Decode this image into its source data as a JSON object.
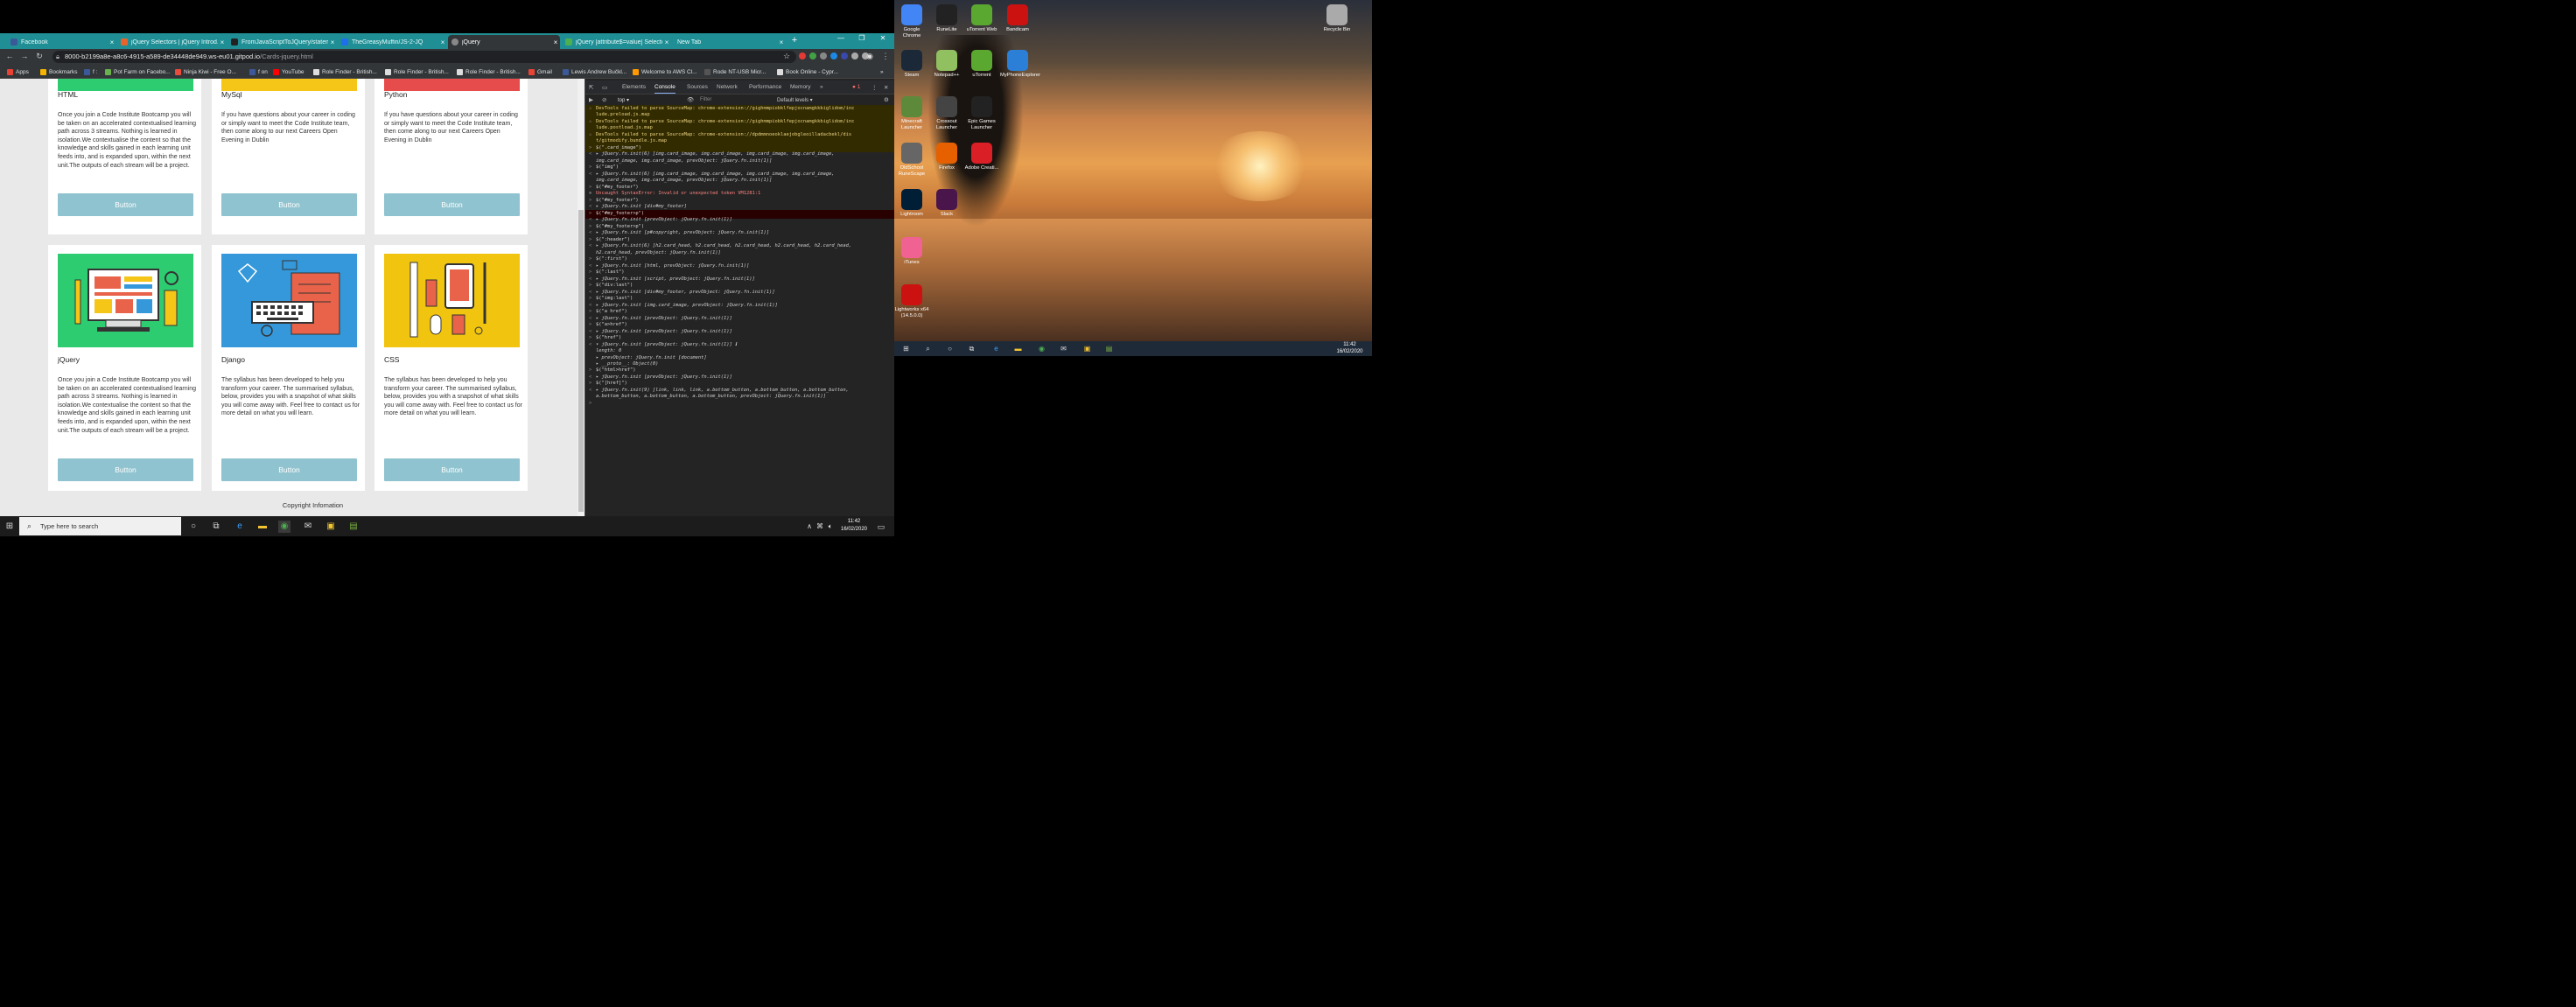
{
  "browser": {
    "tabs": [
      {
        "label": "Facebook",
        "color": "#3b5998",
        "active": false
      },
      {
        "label": "jQuery Selectors | jQuery Introd...",
        "color": "#e8632b",
        "active": false
      },
      {
        "label": "FromJavaScriptToJQuery/statem...",
        "color": "#222222",
        "active": false
      },
      {
        "label": "TheGreasyMuffin/JS-2-JQ",
        "color": "#1f6feb",
        "active": false
      },
      {
        "label": "jQuery",
        "color": "#888888",
        "active": true
      },
      {
        "label": "jQuery [attribute$=value] Selecto...",
        "color": "#4caf50",
        "active": false
      },
      {
        "label": "New Tab",
        "color": "#888888",
        "active": false
      }
    ],
    "url_main": "8000-b2199a8e-a8c6-4915-a589-de34448de949.ws-eu01.gitpod.io",
    "url_path": "/Cards-jquery.html",
    "bookmarks": [
      {
        "label": "Apps",
        "color": "#e94235"
      },
      {
        "label": "Bookmarks",
        "color": "#f4b400"
      },
      {
        "label": "f :",
        "color": "#3b5998"
      },
      {
        "label": "Pot Farm on Facebo...",
        "color": "#6ab04c"
      },
      {
        "label": "Ninja Kiwi - Free O...",
        "color": "#e74c3c"
      },
      {
        "label": "f on",
        "color": "#3b5998"
      },
      {
        "label": "YouTube",
        "color": "#ff0000"
      },
      {
        "label": "Role Finder - British...",
        "color": "#dddddd"
      },
      {
        "label": "Role Finder - British...",
        "color": "#dddddd"
      },
      {
        "label": "Role Finder - British...",
        "color": "#dddddd"
      },
      {
        "label": "Gmail",
        "color": "#ea4335"
      },
      {
        "label": "Lewis Andrew Bučkl...",
        "color": "#3b5998"
      },
      {
        "label": "Welcome to AWS Cl...",
        "color": "#ff9900"
      },
      {
        "label": "Rode NT-USB Micr...",
        "color": "#555555"
      },
      {
        "label": "Book Online - Cypr...",
        "color": "#dddddd"
      }
    ]
  },
  "cards": [
    {
      "title": "HTML",
      "text": "Once you join a Code Institute Bootcamp you will be taken on an accelerated contextualised learning path across 3 streams. Nothing is learned in isolation.We contextualise the content so that the knowledge and skills gained in each learning unit feeds into, and is expanded upon, within the next unit.The outputs of each stream will be a project.",
      "button": "Button",
      "img_color": "#2ecc71"
    },
    {
      "title": "MySql",
      "text": "If you have questions about your career in coding or simply want to meet the Code Institute team, then come along to our next Careers Open Evening in Dublin",
      "button": "Button",
      "img_color": "#f5c518"
    },
    {
      "title": "Python",
      "text": "If you have questions about your career in coding or simply want to meet the Code Institute team, then come along to our next Careers Open Evening in Dublin",
      "button": "Button",
      "img_color": "#e74c4c"
    },
    {
      "title": "jQuery",
      "text": "Once you join a Code Institute Bootcamp you will be taken on an accelerated contextualised learning path across 3 streams. Nothing is learned in isolation.We contextualise the content so that the knowledge and skills gained in each learning unit feeds into, and is expanded upon, within the next unit.The outputs of each stream will be a project.",
      "button": "Button",
      "img_color": "#2ecc71"
    },
    {
      "title": "Django",
      "text": "The syllabus has been developed to help you transform your career. The summarised syllabus, below, provides you with a snapshot of what skills you will come away with. Feel free to contact us for more detail on what you will learn.",
      "button": "Button",
      "img_color": "#3498db"
    },
    {
      "title": "CSS",
      "text": "The syllabus has been developed to help you transform your career. The summarised syllabus, below, provides you with a snapshot of what skills you will come away with. Feel free to contact us for more detail on what you will learn.",
      "button": "Button",
      "img_color": "#f1c40f"
    }
  ],
  "footer": "Copyright Infomation",
  "devtools": {
    "tabs": [
      "Elements",
      "Console",
      "Sources",
      "Network",
      "Performance",
      "Memory"
    ],
    "active_tab": "Console",
    "error_count": "1",
    "context": "top",
    "filter_placeholder": "Filter",
    "levels": "Default levels ▾",
    "lines": [
      {
        "t": "warn",
        "m": "⚠",
        "x": "DevTools failed to parse SourceMap: chrome-extension://gighmmpiobklfepjocnamgkkbiglidom/inc"
      },
      {
        "t": "warn",
        "m": "",
        "x": "lude.preload.js.map"
      },
      {
        "t": "warn",
        "m": "⚠",
        "x": "DevTools failed to parse SourceMap: chrome-extension://gighmmpiobklfepjocnamgkkbiglidom/inc"
      },
      {
        "t": "warn",
        "m": "",
        "x": "lude.postload.js.map"
      },
      {
        "t": "warn",
        "m": "⚠",
        "x": "DevTools failed to parse SourceMap: chrome-extension://dpdmmnoeoklaejobgleoilladacbekl/dis"
      },
      {
        "t": "warn",
        "m": "",
        "x": "t/gitmodify.bundle.js.map"
      },
      {
        "t": "in",
        "m": ">",
        "x": "$(\".card_image\")"
      },
      {
        "t": "out",
        "m": "<",
        "x": "▸ jQuery.fn.init(6) [img.card_image, img.card_image, img.card_image, img.card_image,"
      },
      {
        "t": "out",
        "m": "",
        "x": "  img.card_image, img.card_image, prevObject: jQuery.fn.init(1)]"
      },
      {
        "t": "in",
        "m": ">",
        "x": "$(\"img\")"
      },
      {
        "t": "out",
        "m": "<",
        "x": "▸ jQuery.fn.init(6) [img.card_image, img.card_image, img.card_image, img.card_image,"
      },
      {
        "t": "out",
        "m": "",
        "x": "  img.card_image, img.card_image, prevObject: jQuery.fn.init(1)]"
      },
      {
        "t": "in",
        "m": ">",
        "x": "$(\"#my_footer\")"
      },
      {
        "t": "err",
        "m": "⊗",
        "x": "Uncaught SyntaxError: Invalid or unexpected token                              VM1281:1"
      },
      {
        "t": "in",
        "m": ">",
        "x": "$(\"#my_footer\")"
      },
      {
        "t": "out",
        "m": "<",
        "x": "▸ jQuery.fn.init [div#my_footer]"
      },
      {
        "t": "in",
        "m": ">",
        "x": "$(\"#my_footer>p\")"
      },
      {
        "t": "out",
        "m": "<",
        "x": "▸ jQuery.fn.init [prevObject: jQuery.fn.init(1)]"
      },
      {
        "t": "in",
        "m": ">",
        "x": "$(\"#my_footer>p\")"
      },
      {
        "t": "out",
        "m": "<",
        "x": "▸ jQuery.fn.init [p#copyright, prevObject: jQuery.fn.init(1)]"
      },
      {
        "t": "in",
        "m": ">",
        "x": "$(\":header\")"
      },
      {
        "t": "out",
        "m": "<",
        "x": "▸ jQuery.fn.init(6) [h2.card_head, h2.card_head, h2.card_head, h2.card_head, h2.card_head,"
      },
      {
        "t": "out",
        "m": "",
        "x": "  h2.card_head, prevObject: jQuery.fn.init(1)]"
      },
      {
        "t": "in",
        "m": ">",
        "x": "$(\":first\")"
      },
      {
        "t": "out",
        "m": "<",
        "x": "▸ jQuery.fn.init [html, prevObject: jQuery.fn.init(1)]"
      },
      {
        "t": "in",
        "m": ">",
        "x": "$(\":last\")"
      },
      {
        "t": "out",
        "m": "<",
        "x": "▸ jQuery.fn.init [script, prevObject: jQuery.fn.init(1)]"
      },
      {
        "t": "in",
        "m": ">",
        "x": "$(\"div:last\")"
      },
      {
        "t": "out",
        "m": "<",
        "x": "▸ jQuery.fn.init [div#my_footer, prevObject: jQuery.fn.init(1)]"
      },
      {
        "t": "in",
        "m": ">",
        "x": "$(\"img:last\")"
      },
      {
        "t": "out",
        "m": "<",
        "x": "▸ jQuery.fn.init [img.card_image, prevObject: jQuery.fn.init(1)]"
      },
      {
        "t": "in",
        "m": ">",
        "x": "$(\"a href\")"
      },
      {
        "t": "out",
        "m": "<",
        "x": "▸ jQuery.fn.init [prevObject: jQuery.fn.init(1)]"
      },
      {
        "t": "in",
        "m": ">",
        "x": "$(\"a>href\")"
      },
      {
        "t": "out",
        "m": "<",
        "x": "▸ jQuery.fn.init [prevObject: jQuery.fn.init(1)]"
      },
      {
        "t": "in",
        "m": ">",
        "x": "$(\"href\")"
      },
      {
        "t": "out",
        "m": "<",
        "x": "▾ jQuery.fn.init [prevObject: jQuery.fn.init(1)] ℹ"
      },
      {
        "t": "out",
        "m": "",
        "x": "    length: 0"
      },
      {
        "t": "out",
        "m": "",
        "x": "  ▸ prevObject: jQuery.fn.init [document]"
      },
      {
        "t": "out",
        "m": "",
        "x": "  ▸ __proto__: Object(0)"
      },
      {
        "t": "in",
        "m": ">",
        "x": "$(\"html>href\")"
      },
      {
        "t": "out",
        "m": "<",
        "x": "▸ jQuery.fn.init [prevObject: jQuery.fn.init(1)]"
      },
      {
        "t": "in",
        "m": ">",
        "x": "$(\"[href]\")"
      },
      {
        "t": "out",
        "m": "<",
        "x": "▸ jQuery.fn.init(9) [link, link, link, a.bottom_button, a.bottom_button, a.bottom_button,"
      },
      {
        "t": "out",
        "m": "",
        "x": "  a.bottom_button, a.bottom_button, a.bottom_button, prevObject: jQuery.fn.init(1)]"
      },
      {
        "t": "in",
        "m": ">",
        "x": ""
      }
    ]
  },
  "desktop_icons": [
    {
      "label": "Google Chrome",
      "color": "#4285f4"
    },
    {
      "label": "RuneLite",
      "color": "#222222"
    },
    {
      "label": "uTorrent Web",
      "color": "#5aa830"
    },
    {
      "label": "Bandicam",
      "color": "#cc1111"
    },
    {
      "label": "Steam",
      "color": "#1b2838"
    },
    {
      "label": "Notepad++",
      "color": "#90c060"
    },
    {
      "label": "uTorrent",
      "color": "#5aa830"
    },
    {
      "label": "MyPhoneExplorer",
      "color": "#2b7fd6"
    },
    {
      "label": "Minecraft Launcher",
      "color": "#5d8a3a"
    },
    {
      "label": "Crossout Launcher",
      "color": "#444444"
    },
    {
      "label": "Epic Games Launcher",
      "color": "#222222"
    },
    {
      "label": "OldSchool RuneScape",
      "color": "#666666"
    },
    {
      "label": "Firefox",
      "color": "#e66000"
    },
    {
      "label": "Adobe Creati...",
      "color": "#da1f26"
    },
    {
      "label": "Lightroom",
      "color": "#001e36"
    },
    {
      "label": "Slack",
      "color": "#4a154b"
    },
    {
      "label": "iTunes",
      "color": "#f06292"
    },
    {
      "label": "Lightworks x64 (14.5.0.0)",
      "color": "#cc1111"
    },
    {
      "label": "Recycle Bin",
      "color": "#aaaaaa"
    }
  ],
  "taskbar": {
    "search_placeholder": "Type here to search",
    "time": "11:42",
    "date": "16/02/2020",
    "time2": "11:42",
    "date2": "16/02/2020"
  }
}
